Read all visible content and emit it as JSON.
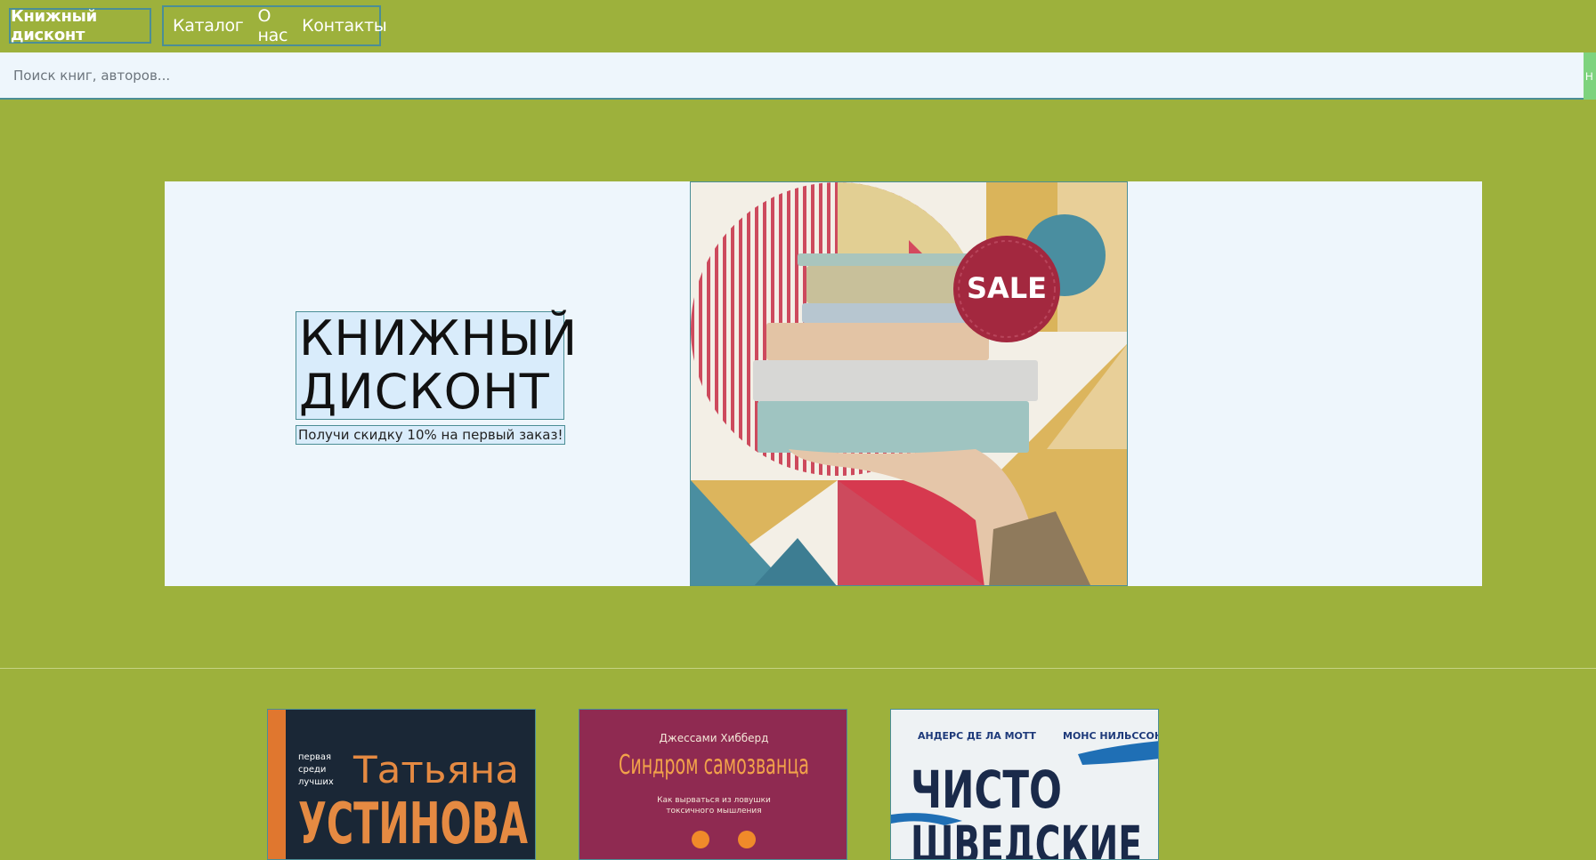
{
  "header": {
    "logo": "Книжный дисконт",
    "nav": [
      "Каталог",
      "О нас",
      "Контакты"
    ]
  },
  "search": {
    "placeholder": "Поиск книг, авторов...",
    "button_label": "Н"
  },
  "hero": {
    "title_line1": "КНИЖНЫЙ",
    "title_line2": "ДИСКОНТ",
    "subtitle": "Получи скидку 10% на первый заказ!",
    "image_badge": "SALE"
  },
  "books": [
    {
      "tagline": [
        "первая",
        "среди",
        "лучших"
      ],
      "author_first": "Татьяна",
      "author_last": "УСТИНОВА"
    },
    {
      "author": "Джессами Хибберд",
      "title": "Синдром самозванца",
      "subtitle": [
        "Как вырваться из ловушки",
        "токсичного мышления"
      ]
    },
    {
      "author_left": "АНДЕРС ДЕ ЛА МОТТ",
      "author_right": "МОНС НИЛЬССОН",
      "title_line1": "ЧИСТО",
      "title_line2": "ШВЕДСКИЕ"
    }
  ],
  "colors": {
    "background": "#9db13c",
    "hero_bg": "#eef6fc",
    "border": "#4b8e96",
    "sale_badge": "#a3283f"
  }
}
